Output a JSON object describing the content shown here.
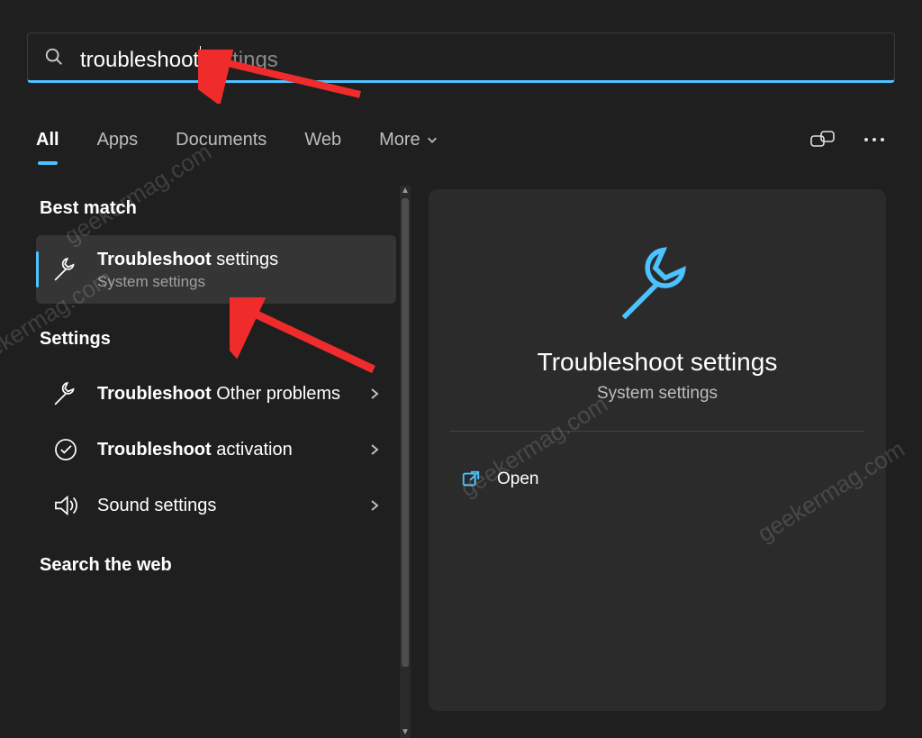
{
  "search": {
    "typed": "troubleshoot",
    "suggest": "settings"
  },
  "tabs": {
    "all": "All",
    "apps": "Apps",
    "documents": "Documents",
    "web": "Web",
    "more": "More"
  },
  "sections": {
    "best_match": "Best match",
    "settings": "Settings",
    "search_web": "Search the web"
  },
  "results": {
    "best": {
      "title_bold": "Troubleshoot",
      "title_rest": " settings",
      "sub": "System settings"
    },
    "settings": [
      {
        "title_bold": "Troubleshoot",
        "title_rest": " Other problems"
      },
      {
        "title_bold": "Troubleshoot",
        "title_rest": " activation"
      },
      {
        "title_bold": "",
        "title_rest": "Sound settings"
      }
    ]
  },
  "detail": {
    "title": "Troubleshoot settings",
    "sub": "System settings",
    "open": "Open"
  },
  "watermark": "geekermag.com"
}
